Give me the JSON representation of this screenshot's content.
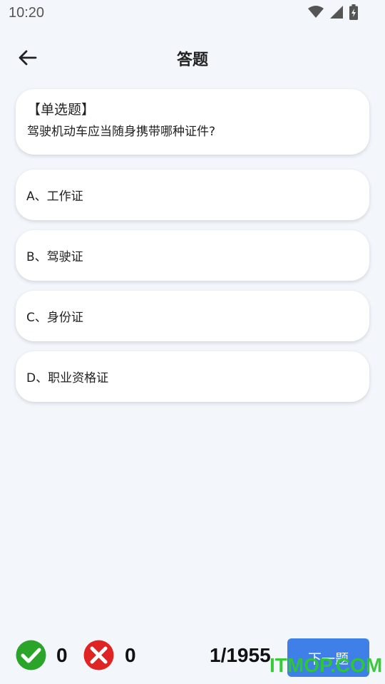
{
  "status_bar": {
    "time": "10:20",
    "icons": [
      "wifi-icon",
      "signal-icon",
      "battery-icon"
    ]
  },
  "header": {
    "title": "答题",
    "back_icon": "arrow-left-icon"
  },
  "question": {
    "type_label": "【单选题】",
    "text": "驾驶机动车应当随身携带哪种证件?"
  },
  "options": [
    {
      "label": "A、工作证"
    },
    {
      "label": "B、驾驶证"
    },
    {
      "label": "C、身份证"
    },
    {
      "label": "D、职业资格证"
    }
  ],
  "footer": {
    "correct_count": "0",
    "wrong_count": "0",
    "progress": "1/1955",
    "next_label": "下一题"
  },
  "watermark": "ITMOP.COM",
  "colors": {
    "correct": "#2aa52a",
    "wrong": "#e02424",
    "accent": "#3f7fe8"
  }
}
